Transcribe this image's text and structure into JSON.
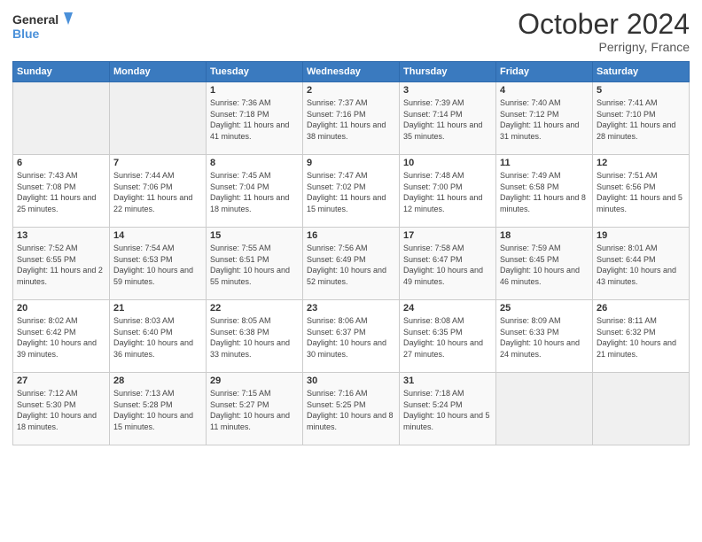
{
  "header": {
    "logo_line1": "General",
    "logo_line2": "Blue",
    "month": "October 2024",
    "location": "Perrigny, France"
  },
  "weekdays": [
    "Sunday",
    "Monday",
    "Tuesday",
    "Wednesday",
    "Thursday",
    "Friday",
    "Saturday"
  ],
  "weeks": [
    [
      {
        "day": "",
        "info": ""
      },
      {
        "day": "",
        "info": ""
      },
      {
        "day": "1",
        "info": "Sunrise: 7:36 AM\nSunset: 7:18 PM\nDaylight: 11 hours and 41 minutes."
      },
      {
        "day": "2",
        "info": "Sunrise: 7:37 AM\nSunset: 7:16 PM\nDaylight: 11 hours and 38 minutes."
      },
      {
        "day": "3",
        "info": "Sunrise: 7:39 AM\nSunset: 7:14 PM\nDaylight: 11 hours and 35 minutes."
      },
      {
        "day": "4",
        "info": "Sunrise: 7:40 AM\nSunset: 7:12 PM\nDaylight: 11 hours and 31 minutes."
      },
      {
        "day": "5",
        "info": "Sunrise: 7:41 AM\nSunset: 7:10 PM\nDaylight: 11 hours and 28 minutes."
      }
    ],
    [
      {
        "day": "6",
        "info": "Sunrise: 7:43 AM\nSunset: 7:08 PM\nDaylight: 11 hours and 25 minutes."
      },
      {
        "day": "7",
        "info": "Sunrise: 7:44 AM\nSunset: 7:06 PM\nDaylight: 11 hours and 22 minutes."
      },
      {
        "day": "8",
        "info": "Sunrise: 7:45 AM\nSunset: 7:04 PM\nDaylight: 11 hours and 18 minutes."
      },
      {
        "day": "9",
        "info": "Sunrise: 7:47 AM\nSunset: 7:02 PM\nDaylight: 11 hours and 15 minutes."
      },
      {
        "day": "10",
        "info": "Sunrise: 7:48 AM\nSunset: 7:00 PM\nDaylight: 11 hours and 12 minutes."
      },
      {
        "day": "11",
        "info": "Sunrise: 7:49 AM\nSunset: 6:58 PM\nDaylight: 11 hours and 8 minutes."
      },
      {
        "day": "12",
        "info": "Sunrise: 7:51 AM\nSunset: 6:56 PM\nDaylight: 11 hours and 5 minutes."
      }
    ],
    [
      {
        "day": "13",
        "info": "Sunrise: 7:52 AM\nSunset: 6:55 PM\nDaylight: 11 hours and 2 minutes."
      },
      {
        "day": "14",
        "info": "Sunrise: 7:54 AM\nSunset: 6:53 PM\nDaylight: 10 hours and 59 minutes."
      },
      {
        "day": "15",
        "info": "Sunrise: 7:55 AM\nSunset: 6:51 PM\nDaylight: 10 hours and 55 minutes."
      },
      {
        "day": "16",
        "info": "Sunrise: 7:56 AM\nSunset: 6:49 PM\nDaylight: 10 hours and 52 minutes."
      },
      {
        "day": "17",
        "info": "Sunrise: 7:58 AM\nSunset: 6:47 PM\nDaylight: 10 hours and 49 minutes."
      },
      {
        "day": "18",
        "info": "Sunrise: 7:59 AM\nSunset: 6:45 PM\nDaylight: 10 hours and 46 minutes."
      },
      {
        "day": "19",
        "info": "Sunrise: 8:01 AM\nSunset: 6:44 PM\nDaylight: 10 hours and 43 minutes."
      }
    ],
    [
      {
        "day": "20",
        "info": "Sunrise: 8:02 AM\nSunset: 6:42 PM\nDaylight: 10 hours and 39 minutes."
      },
      {
        "day": "21",
        "info": "Sunrise: 8:03 AM\nSunset: 6:40 PM\nDaylight: 10 hours and 36 minutes."
      },
      {
        "day": "22",
        "info": "Sunrise: 8:05 AM\nSunset: 6:38 PM\nDaylight: 10 hours and 33 minutes."
      },
      {
        "day": "23",
        "info": "Sunrise: 8:06 AM\nSunset: 6:37 PM\nDaylight: 10 hours and 30 minutes."
      },
      {
        "day": "24",
        "info": "Sunrise: 8:08 AM\nSunset: 6:35 PM\nDaylight: 10 hours and 27 minutes."
      },
      {
        "day": "25",
        "info": "Sunrise: 8:09 AM\nSunset: 6:33 PM\nDaylight: 10 hours and 24 minutes."
      },
      {
        "day": "26",
        "info": "Sunrise: 8:11 AM\nSunset: 6:32 PM\nDaylight: 10 hours and 21 minutes."
      }
    ],
    [
      {
        "day": "27",
        "info": "Sunrise: 7:12 AM\nSunset: 5:30 PM\nDaylight: 10 hours and 18 minutes."
      },
      {
        "day": "28",
        "info": "Sunrise: 7:13 AM\nSunset: 5:28 PM\nDaylight: 10 hours and 15 minutes."
      },
      {
        "day": "29",
        "info": "Sunrise: 7:15 AM\nSunset: 5:27 PM\nDaylight: 10 hours and 11 minutes."
      },
      {
        "day": "30",
        "info": "Sunrise: 7:16 AM\nSunset: 5:25 PM\nDaylight: 10 hours and 8 minutes."
      },
      {
        "day": "31",
        "info": "Sunrise: 7:18 AM\nSunset: 5:24 PM\nDaylight: 10 hours and 5 minutes."
      },
      {
        "day": "",
        "info": ""
      },
      {
        "day": "",
        "info": ""
      }
    ]
  ]
}
